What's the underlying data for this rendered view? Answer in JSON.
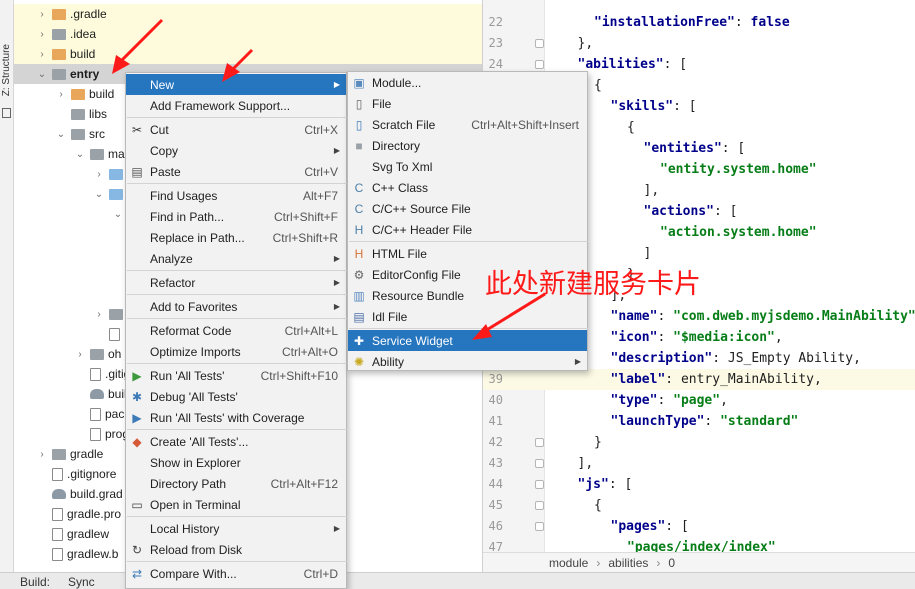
{
  "strip": {
    "label": "Z: Structure",
    "icon": "structure-icon"
  },
  "tree": {
    "rows": [
      {
        "label": ".gradle",
        "icon": "folder-orange-icon",
        "arrow": "›",
        "indent": 1
      },
      {
        "label": ".idea",
        "icon": "folder-gray-icon",
        "arrow": "›",
        "indent": 1
      },
      {
        "label": "build",
        "icon": "folder-orange-icon",
        "arrow": "›",
        "indent": 1
      },
      {
        "label": "entry",
        "icon": "folder-gray-icon",
        "arrow": "⌄",
        "indent": 1
      },
      {
        "label": "build",
        "icon": "folder-orange-icon",
        "arrow": "›",
        "indent": 2
      },
      {
        "label": "libs",
        "icon": "folder-gray-icon",
        "arrow": "",
        "indent": 2
      },
      {
        "label": "src",
        "icon": "folder-gray-icon",
        "arrow": "⌄",
        "indent": 2
      },
      {
        "label": "ma",
        "icon": "folder-gray-icon",
        "arrow": "⌄",
        "indent": 3
      },
      {
        "label": "",
        "icon": "folder-blue-icon",
        "arrow": "›",
        "indent": 4
      },
      {
        "label": "",
        "icon": "folder-blue-icon",
        "arrow": "⌄",
        "indent": 4
      },
      {
        "label": "",
        "icon": "",
        "arrow": "⌄",
        "indent": 5
      },
      {
        "label": "",
        "icon": "",
        "arrow": "",
        "indent": 5
      },
      {
        "label": "",
        "icon": "",
        "arrow": "",
        "indent": 5
      },
      {
        "label": "",
        "icon": "",
        "arrow": "",
        "indent": 5
      },
      {
        "label": "",
        "icon": "",
        "arrow": "",
        "indent": 5
      },
      {
        "label": "",
        "icon": "folder-gray-icon",
        "arrow": "›",
        "indent": 4
      },
      {
        "label": "",
        "icon": "file-icon",
        "arrow": "",
        "indent": 4
      },
      {
        "label": "oh",
        "icon": "folder-gray-icon",
        "arrow": "›",
        "indent": 3
      },
      {
        "label": ".gitign",
        "icon": "file-icon",
        "arrow": "",
        "indent": 3
      },
      {
        "label": "build.g",
        "icon": "gradle-icon",
        "arrow": "",
        "indent": 3
      },
      {
        "label": "packa",
        "icon": "file-icon",
        "arrow": "",
        "indent": 3
      },
      {
        "label": "progu",
        "icon": "file-icon",
        "arrow": "",
        "indent": 3
      },
      {
        "label": "gradle",
        "icon": "folder-gray-icon",
        "arrow": "›",
        "indent": 1
      },
      {
        "label": ".gitignore",
        "icon": "file-icon",
        "arrow": "",
        "indent": 1
      },
      {
        "label": "build.grad",
        "icon": "gradle-icon",
        "arrow": "",
        "indent": 1
      },
      {
        "label": "gradle.pro",
        "icon": "file-icon",
        "arrow": "",
        "indent": 1
      },
      {
        "label": "gradlew",
        "icon": "file-icon",
        "arrow": "",
        "indent": 1
      },
      {
        "label": "gradlew.b",
        "icon": "file-icon",
        "arrow": "",
        "indent": 1
      }
    ]
  },
  "editor": {
    "lines": [
      {
        "n": "22",
        "html": [
          [
            "k",
            "\"installationFree\""
          ],
          [
            "v",
            ": "
          ],
          [
            "kw",
            "false"
          ]
        ],
        "indent": 2
      },
      {
        "n": "23",
        "html": [
          [
            "v",
            "},"
          ]
        ],
        "indent": 1
      },
      {
        "n": "24",
        "html": [
          [
            "k",
            "\"abilities\""
          ],
          [
            "v",
            ": ["
          ]
        ],
        "indent": 1
      },
      {
        "n": "25",
        "html": [
          [
            "v",
            "{"
          ]
        ],
        "indent": 2
      },
      {
        "n": "26",
        "html": [
          [
            "k",
            "\"skills\""
          ],
          [
            "v",
            ": ["
          ]
        ],
        "indent": 3
      },
      {
        "n": "27",
        "html": [
          [
            "v",
            "{"
          ]
        ],
        "indent": 4
      },
      {
        "n": "28",
        "html": [
          [
            "k",
            "\"entities\""
          ],
          [
            "v",
            ": ["
          ]
        ],
        "indent": 5
      },
      {
        "n": "29",
        "html": [
          [
            "s",
            "\"entity.system.home\""
          ]
        ],
        "indent": 6
      },
      {
        "n": "30",
        "html": [
          [
            "v",
            "],"
          ]
        ],
        "indent": 5
      },
      {
        "n": "31",
        "html": [
          [
            "k",
            "\"actions\""
          ],
          [
            "v",
            ": ["
          ]
        ],
        "indent": 5
      },
      {
        "n": "32",
        "html": [
          [
            "s",
            "\"action.system.home\""
          ]
        ],
        "indent": 6
      },
      {
        "n": "33",
        "html": [
          [
            "v",
            "]"
          ]
        ],
        "indent": 5
      },
      {
        "n": "34",
        "html": [
          [
            "v",
            "}"
          ]
        ],
        "indent": 4
      },
      {
        "n": "35",
        "html": [
          [
            "v",
            "],"
          ]
        ],
        "indent": 3
      },
      {
        "n": "36",
        "html": [
          [
            "k",
            "\"name\""
          ],
          [
            "v",
            ": "
          ],
          [
            "s",
            "\"com.dweb.myjsdemo.MainAbility\""
          ]
        ],
        "indent": 3
      },
      {
        "n": "37",
        "html": [
          [
            "k",
            "\"icon\""
          ],
          [
            "v",
            ": "
          ],
          [
            "s",
            "\"$media:icon\""
          ],
          [
            "v",
            ","
          ]
        ],
        "indent": 3
      },
      {
        "n": "38",
        "html": [
          [
            "k",
            "\"description\""
          ],
          [
            "v",
            ": JS_Empty Ability,"
          ]
        ],
        "indent": 3
      },
      {
        "n": "39",
        "html": [
          [
            "k",
            "\"label\""
          ],
          [
            "v",
            ": entry_MainAbility,"
          ]
        ],
        "indent": 3
      },
      {
        "n": "40",
        "html": [
          [
            "k",
            "\"type\""
          ],
          [
            "v",
            ": "
          ],
          [
            "s",
            "\"page\""
          ],
          [
            "v",
            ","
          ]
        ],
        "indent": 3
      },
      {
        "n": "41",
        "html": [
          [
            "k",
            "\"launchType\""
          ],
          [
            "v",
            ": "
          ],
          [
            "s",
            "\"standard\""
          ]
        ],
        "indent": 3
      },
      {
        "n": "42",
        "html": [
          [
            "v",
            "}"
          ]
        ],
        "indent": 2
      },
      {
        "n": "43",
        "html": [
          [
            "v",
            "],"
          ]
        ],
        "indent": 1
      },
      {
        "n": "44",
        "html": [
          [
            "k",
            "\"js\""
          ],
          [
            "v",
            ": ["
          ]
        ],
        "indent": 1
      },
      {
        "n": "45",
        "html": [
          [
            "v",
            "{"
          ]
        ],
        "indent": 2
      },
      {
        "n": "46",
        "html": [
          [
            "k",
            "\"pages\""
          ],
          [
            "v",
            ": ["
          ]
        ],
        "indent": 3
      },
      {
        "n": "47",
        "html": [
          [
            "s",
            "\"pages/index/index\""
          ]
        ],
        "indent": 4
      }
    ]
  },
  "breadcrumb": {
    "items": [
      "module",
      "abilities",
      "0"
    ],
    "separator": "›"
  },
  "bottombar": {
    "build_label": "Build:",
    "sync_label": "Sync"
  },
  "context_menu": {
    "items": [
      {
        "label": "New",
        "shortcut": "",
        "submenu": true,
        "icon": "",
        "active": true
      },
      {
        "label": "Add Framework Support...",
        "shortcut": "",
        "icon": ""
      },
      {
        "sep": true
      },
      {
        "label": "Cut",
        "shortcut": "Ctrl+X",
        "icon": "scissors-icon"
      },
      {
        "label": "Copy",
        "shortcut": "",
        "submenu": true,
        "icon": ""
      },
      {
        "label": "Paste",
        "shortcut": "Ctrl+V",
        "icon": "clipboard-icon"
      },
      {
        "sep": true
      },
      {
        "label": "Find Usages",
        "shortcut": "Alt+F7",
        "icon": ""
      },
      {
        "label": "Find in Path...",
        "shortcut": "Ctrl+Shift+F",
        "icon": ""
      },
      {
        "label": "Replace in Path...",
        "shortcut": "Ctrl+Shift+R",
        "icon": ""
      },
      {
        "label": "Analyze",
        "shortcut": "",
        "submenu": true,
        "icon": ""
      },
      {
        "sep": true
      },
      {
        "label": "Refactor",
        "shortcut": "",
        "submenu": true,
        "icon": ""
      },
      {
        "sep": true
      },
      {
        "label": "Add to Favorites",
        "shortcut": "",
        "submenu": true,
        "icon": ""
      },
      {
        "sep": true
      },
      {
        "label": "Reformat Code",
        "shortcut": "Ctrl+Alt+L",
        "icon": ""
      },
      {
        "label": "Optimize Imports",
        "shortcut": "Ctrl+Alt+O",
        "icon": ""
      },
      {
        "sep": true
      },
      {
        "label": "Run 'All Tests'",
        "shortcut": "Ctrl+Shift+F10",
        "icon": "run-icon"
      },
      {
        "label": "Debug 'All Tests'",
        "shortcut": "",
        "icon": "debug-icon"
      },
      {
        "label": "Run 'All Tests' with Coverage",
        "shortcut": "",
        "icon": "coverage-icon"
      },
      {
        "sep": true
      },
      {
        "label": "Create 'All Tests'...",
        "shortcut": "",
        "icon": "create-config-icon"
      },
      {
        "label": "Show in Explorer",
        "shortcut": "",
        "icon": ""
      },
      {
        "label": "Directory Path",
        "shortcut": "Ctrl+Alt+F12",
        "icon": ""
      },
      {
        "label": "Open in Terminal",
        "shortcut": "",
        "icon": "terminal-icon"
      },
      {
        "sep": true
      },
      {
        "label": "Local History",
        "shortcut": "",
        "submenu": true,
        "icon": ""
      },
      {
        "label": "Reload from Disk",
        "shortcut": "",
        "icon": "reload-icon"
      },
      {
        "sep": true
      },
      {
        "label": "Compare With...",
        "shortcut": "Ctrl+D",
        "icon": "compare-icon"
      }
    ]
  },
  "submenu_new": {
    "items": [
      {
        "label": "Module...",
        "shortcut": "",
        "icon": "module-icon"
      },
      {
        "label": "File",
        "shortcut": "",
        "icon": "file-icon"
      },
      {
        "label": "Scratch File",
        "shortcut": "Ctrl+Alt+Shift+Insert",
        "icon": "scratch-file-icon"
      },
      {
        "label": "Directory",
        "shortcut": "",
        "icon": "folder-icon"
      },
      {
        "label": "Svg To Xml",
        "shortcut": "",
        "icon": ""
      },
      {
        "label": "C++ Class",
        "shortcut": "",
        "icon": "cpp-class-icon"
      },
      {
        "label": "C/C++ Source File",
        "shortcut": "",
        "icon": "cpp-source-icon"
      },
      {
        "label": "C/C++ Header File",
        "shortcut": "",
        "icon": "cpp-header-icon"
      },
      {
        "sep": true
      },
      {
        "label": "HTML File",
        "shortcut": "",
        "icon": "html-file-icon"
      },
      {
        "label": "EditorConfig File",
        "shortcut": "",
        "icon": "editorconfig-icon"
      },
      {
        "label": "Resource Bundle",
        "shortcut": "",
        "icon": "resource-bundle-icon"
      },
      {
        "label": "Idl File",
        "shortcut": "",
        "icon": "idl-file-icon"
      },
      {
        "sep": true
      },
      {
        "label": "Service Widget",
        "shortcut": "",
        "icon": "puzzle-icon",
        "active": true
      },
      {
        "label": "Ability",
        "shortcut": "",
        "submenu": true,
        "icon": "ability-icon"
      }
    ]
  },
  "annotation": {
    "text": "此处新建服务卡片",
    "color": "#ff1a1a"
  },
  "colors": {
    "menu_highlight": "#2675bf",
    "json_key": "#00008b",
    "json_string": "#067d17"
  }
}
